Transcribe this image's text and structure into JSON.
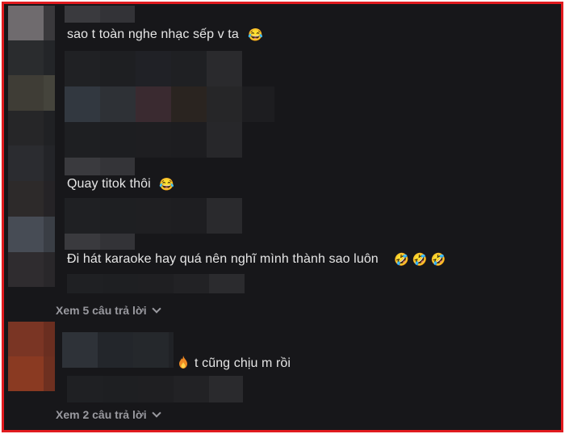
{
  "comments": [
    {
      "text": "sao t toàn nghe nhạc sếp v ta",
      "emoji": "😂"
    },
    {
      "text": "Quay titok thôi",
      "emoji": "😂"
    },
    {
      "text": "Đi hát karaoke hay quá nên nghĩ mình thành sao luôn",
      "emoji": "🤣 🤣 🤣"
    },
    {
      "text": "t cũng chịu m rồi",
      "icon": "fire-icon"
    }
  ],
  "replies": [
    {
      "label": "Xem 5 câu trả lời",
      "icon": "chevron-down-icon"
    },
    {
      "label": "Xem 2 câu trả lời",
      "icon": "chevron-down-icon"
    }
  ],
  "colors": {
    "background": "#17171a",
    "border": "#e11b1f",
    "text": "#e6e6e6",
    "muted": "#9a9aa0"
  }
}
